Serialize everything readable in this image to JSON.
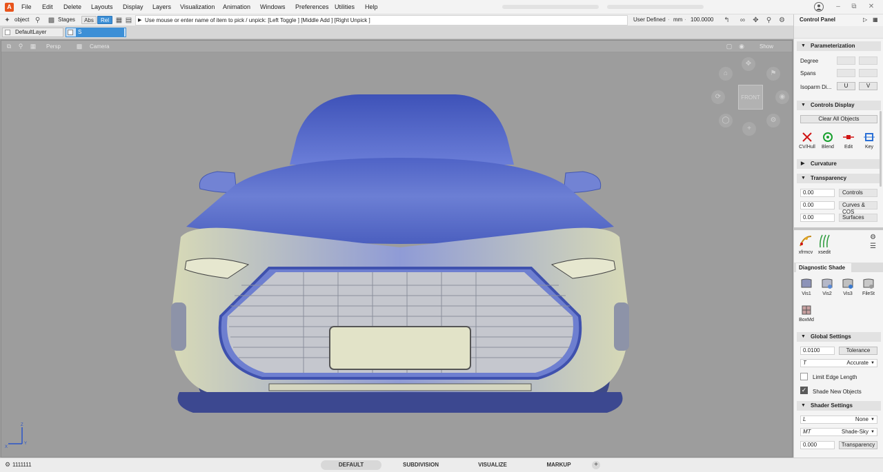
{
  "menubar": {
    "app_logo": "A",
    "items": [
      "File",
      "Edit",
      "Delete",
      "Layouts",
      "Display",
      "Layers",
      "Visualization",
      "Animation",
      "Windows",
      "Preferences",
      "Utilities",
      "Help"
    ]
  },
  "toolbar": {
    "pick_mode": "object",
    "stages_label": "Stages",
    "abs_label": "Abs",
    "rel_label": "Rel",
    "prompt": "Use mouse or enter name of item to pick / unpick: [Left Toggle ] [Middle Add ] [Right Unpick ]",
    "construction_mode": "User Defined",
    "units": "mm",
    "scale": "100.0000"
  },
  "layers": {
    "default_layer": "DefaultLayer",
    "current_layer": "S"
  },
  "viewport": {
    "view": "Persp",
    "camera": "Camera",
    "show_label": "Show",
    "cube_face": "FRONT",
    "axis_labels": [
      "Z",
      "Y",
      "X"
    ]
  },
  "statusbar": {
    "pick_mask": "1111111",
    "tabs": [
      "DEFAULT",
      "SUBDIVISION",
      "VISUALIZE",
      "MARKUP"
    ],
    "active_tab": "DEFAULT"
  },
  "control_panel": {
    "title": "Control Panel",
    "parameterization": {
      "header": "Parameterization",
      "degree": "Degree",
      "spans": "Spans",
      "isoparm": "Isoparm Di...",
      "u": "U",
      "v": "V"
    },
    "controls_display": {
      "header": "Controls Display",
      "clear_all": "Clear All Objects",
      "tools": [
        "CV/Hull",
        "Blend",
        "Edit",
        "Key"
      ]
    },
    "curvature": {
      "header": "Curvature"
    },
    "transparency": {
      "header": "Transparency",
      "rows": [
        {
          "value": "0.00",
          "label": "Controls"
        },
        {
          "value": "0.00",
          "label": "Curves & COS"
        },
        {
          "value": "0.00",
          "label": "Surfaces"
        }
      ]
    },
    "shelf": {
      "tools": [
        "xfrmcv",
        "xsedit"
      ]
    },
    "diagnostic_shade": {
      "header": "Diagnostic Shade",
      "tools": [
        "Vis1",
        "Vis2",
        "Vis3",
        "FileSt",
        "BoxMd"
      ]
    },
    "global_settings": {
      "header": "Global Settings",
      "tolerance_value": "0.0100",
      "tolerance_label": "Tolerance",
      "mode_prefix": "T",
      "mode_value": "Accurate",
      "limit_edge": "Limit Edge Length",
      "limit_edge_checked": false,
      "shade_new": "Shade New Objects",
      "shade_new_checked": true
    },
    "shader_settings": {
      "header": "Shader Settings",
      "l_prefix": "L",
      "l_value": "None",
      "mt_prefix": "MT",
      "mt_value": "Shade-Sky",
      "transparency_value": "0.000",
      "transparency_label": "Transparency"
    }
  },
  "colors": {
    "accent": "#3c8fd6",
    "viewport_bg": "#9d9d9d",
    "logo": "#e8541c",
    "car_blue": "#5a6fd0",
    "car_cream": "#d9dcb8"
  }
}
